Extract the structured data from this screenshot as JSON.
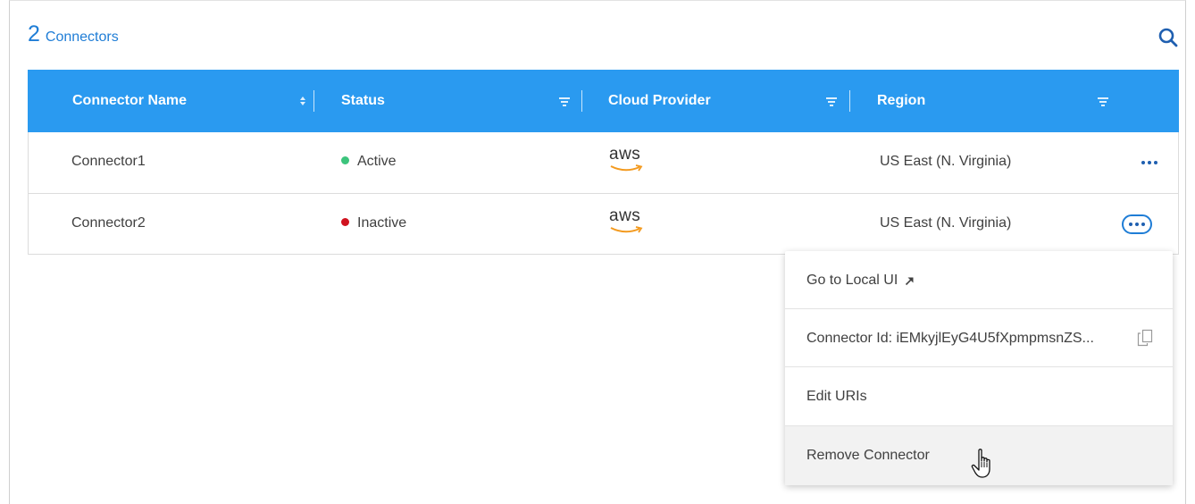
{
  "header": {
    "count": "2",
    "label": "Connectors"
  },
  "columns": [
    {
      "label": "Connector Name",
      "icon": "sort-icon"
    },
    {
      "label": "Status",
      "icon": "filter-icon"
    },
    {
      "label": "Cloud Provider",
      "icon": "filter-icon"
    },
    {
      "label": "Region",
      "icon": "filter-icon"
    }
  ],
  "rows": [
    {
      "name": "Connector1",
      "status": "Active",
      "status_color": "#3cc47c",
      "provider": "aws",
      "region": "US East (N. Virginia)"
    },
    {
      "name": "Connector2",
      "status": "Inactive",
      "status_color": "#d0131f",
      "provider": "aws",
      "region": "US East (N. Virginia)"
    }
  ],
  "menu": {
    "items": [
      {
        "label": "Go to Local UI",
        "icon": "external-link-icon"
      },
      {
        "label": "Connector Id: iEMkyjlEyG4U5fXpmpmsnZS...",
        "icon": "copy-icon"
      },
      {
        "label": "Edit URIs"
      },
      {
        "label": "Remove Connector"
      }
    ]
  },
  "colors": {
    "header_bg": "#2a9af0",
    "accent": "#1f7dd6",
    "aws_orange": "#f39a1f"
  }
}
